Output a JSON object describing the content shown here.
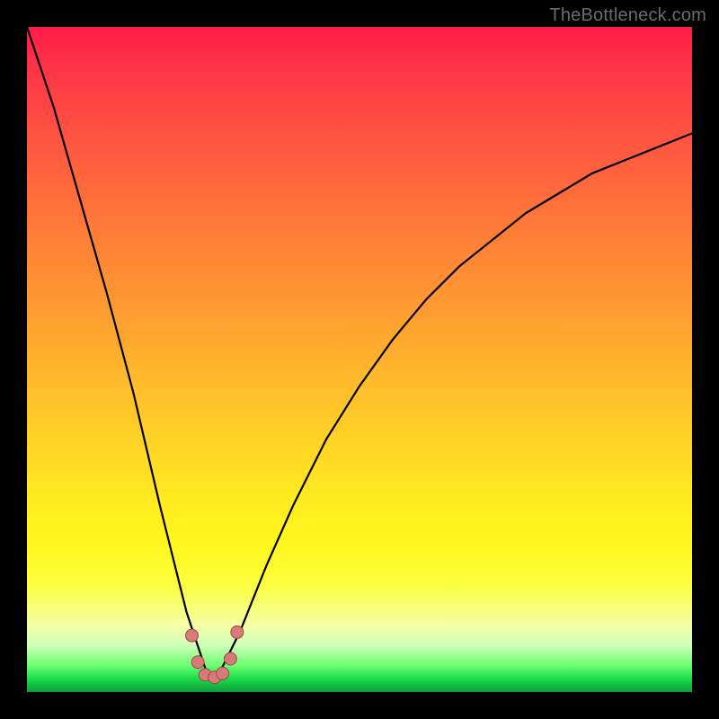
{
  "watermark": {
    "text": "TheBottleneck.com"
  },
  "colors": {
    "frame": "#000000",
    "curve_stroke": "#000000",
    "marker_fill": "#d87a78",
    "marker_stroke": "#9c4a48"
  },
  "chart_data": {
    "type": "line",
    "title": "",
    "xlabel": "",
    "ylabel": "",
    "xlim": [
      0,
      100
    ],
    "ylim": [
      0,
      100
    ],
    "grid": false,
    "legend": false,
    "note": "Axes are unlabeled percentages; y=0 at bottom (green) to y=100 at top (red). Curve is a V / asymmetric parabola with minimum near x≈28, y≈2. Red dots cluster near the minimum.",
    "series": [
      {
        "name": "bottleneck-curve",
        "x": [
          0,
          4,
          8,
          12,
          16,
          20,
          22,
          24,
          26,
          27,
          28,
          29,
          30,
          32,
          34,
          36,
          40,
          45,
          50,
          55,
          60,
          65,
          70,
          75,
          80,
          85,
          90,
          95,
          100
        ],
        "y": [
          100,
          88,
          74,
          60,
          45,
          28,
          20,
          12,
          6,
          3,
          2,
          3,
          5,
          9,
          14,
          19,
          28,
          38,
          46,
          53,
          59,
          64,
          68,
          72,
          75,
          78,
          80,
          82,
          84
        ]
      }
    ],
    "markers": [
      {
        "x": 24.8,
        "y": 8.5
      },
      {
        "x": 25.7,
        "y": 4.5
      },
      {
        "x": 26.8,
        "y": 2.6
      },
      {
        "x": 28.2,
        "y": 2.2
      },
      {
        "x": 29.4,
        "y": 2.8
      },
      {
        "x": 30.6,
        "y": 5.0
      },
      {
        "x": 31.6,
        "y": 9.0
      }
    ]
  }
}
